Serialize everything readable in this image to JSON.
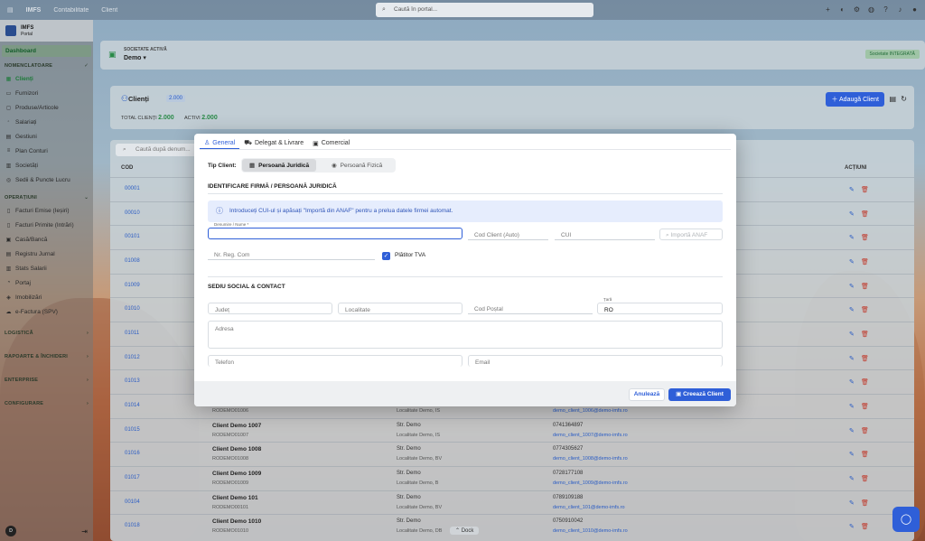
{
  "topbar": {
    "app_name": "IMFS",
    "nav": [
      "Contabilitate",
      "Client"
    ],
    "search_placeholder": "Caută în portal..."
  },
  "sidebar": {
    "app_title": "IMFS",
    "app_subtitle": "Portal",
    "dashboard": "Dashboard",
    "section_nomenclatoare": "NOMENCLATOARE",
    "nomenclatoare": [
      "Clienți",
      "Furnizori",
      "Produse/Articole",
      "Salariați",
      "Gestiuni",
      "Plan Conturi",
      "Societăți",
      "Sedii & Puncte Lucru"
    ],
    "section_operatiuni": "OPERAȚIUNI",
    "operatiuni": [
      "Facturi Emise (Ieșiri)",
      "Facturi Primite (Intrări)",
      "Casă/Bancă",
      "Registru Jurnal",
      "Stats Salarii",
      "Portaj",
      "Imobilizări",
      "e-Factura (SPV)"
    ],
    "sections": [
      "LOGISTICĂ",
      "RAPOARTE & ÎNCHIDERI",
      "ENTERPRISE",
      "CONFIGURARE"
    ],
    "avatar": "D"
  },
  "company": {
    "label": "SOCIETATE ACTIVĂ",
    "name": "Demo",
    "badge": "Societate INTEGRATĂ"
  },
  "clients": {
    "title": "Clienți",
    "count": "2.000",
    "total_label": "TOTAL CLIENȚI",
    "total": "2.000",
    "active_label": "ACTIVI",
    "active": "2.000",
    "add_button": "Adaugă Client"
  },
  "table": {
    "search_placeholder": "Caută după denum...",
    "headers": {
      "cod": "COD",
      "actions": "ACȚIUNI"
    },
    "rows": [
      {
        "code": "00001"
      },
      {
        "code": "00010"
      },
      {
        "code": "00101"
      },
      {
        "code": "01008"
      },
      {
        "code": "01009"
      },
      {
        "code": "01010"
      },
      {
        "code": "01011"
      },
      {
        "code": "01012"
      },
      {
        "code": "01013"
      },
      {
        "code": "01014",
        "name": "",
        "reg": "RODEMO01006",
        "street": "",
        "locality": "Localitate Demo, IS",
        "phone": "",
        "email": "demo_client_1006@demo-imfs.ro"
      },
      {
        "code": "01015",
        "name": "Client Demo 1007",
        "reg": "RODEMO01007",
        "street": "Str. Demo",
        "locality": "Localitate Demo, IS",
        "phone": "0741364897",
        "email": "demo_client_1007@demo-imfs.ro"
      },
      {
        "code": "01016",
        "name": "Client Demo 1008",
        "reg": "RODEMO01008",
        "street": "Str. Demo",
        "locality": "Localitate Demo, BV",
        "phone": "0774305627",
        "email": "demo_client_1008@demo-imfs.ro"
      },
      {
        "code": "01017",
        "name": "Client Demo 1009",
        "reg": "RODEMO01009",
        "street": "Str. Demo",
        "locality": "Localitate Demo, B",
        "phone": "0728177108",
        "email": "demo_client_1009@demo-imfs.ro"
      },
      {
        "code": "00104",
        "name": "Client Demo 101",
        "reg": "RODEMO00101",
        "street": "Str. Demo",
        "locality": "Localitate Demo, BV",
        "phone": "0789109188",
        "email": "demo_client_101@demo-imfs.ro"
      },
      {
        "code": "01018",
        "name": "Client Demo 1010",
        "reg": "RODEMO01010",
        "street": "Str. Demo",
        "locality": "Localitate Demo, DB",
        "phone": "0750910042",
        "email": "demo_client_1010@demo-imfs.ro"
      }
    ]
  },
  "dock": "Dock",
  "modal": {
    "tabs": [
      "General",
      "Delegat & Livrare",
      "Comercial"
    ],
    "tip_client_label": "Tip Client:",
    "tip_options": [
      "Persoană Juridică",
      "Persoană Fizică"
    ],
    "section_identificare": "IDENTIFICARE FIRMĂ / PERSOANĂ JURIDICĂ",
    "info_text": "Introduceți CUI-ul și apăsați \"Importă din ANAF\" pentru a prelua datele firmei automat.",
    "fields": {
      "name_label": "Denumire / Nume *",
      "cod_client": "Cod Client (Auto)",
      "cui": "CUI",
      "anaf_button": "Importă ANAF",
      "nr_reg_com": "Nr. Reg. Com",
      "platitor_tva": "Plătitor TVA",
      "judet": "Județ",
      "localitate": "Localitate",
      "cod_postal": "Cod Poștal",
      "tara_label": "Țară",
      "tara_value": "RO",
      "adresa": "Adresa",
      "telefon": "Telefon",
      "email": "Email"
    },
    "section_sediu": "SEDIU SOCIAL & CONTACT",
    "cancel": "Anulează",
    "create": "Creează Client"
  }
}
